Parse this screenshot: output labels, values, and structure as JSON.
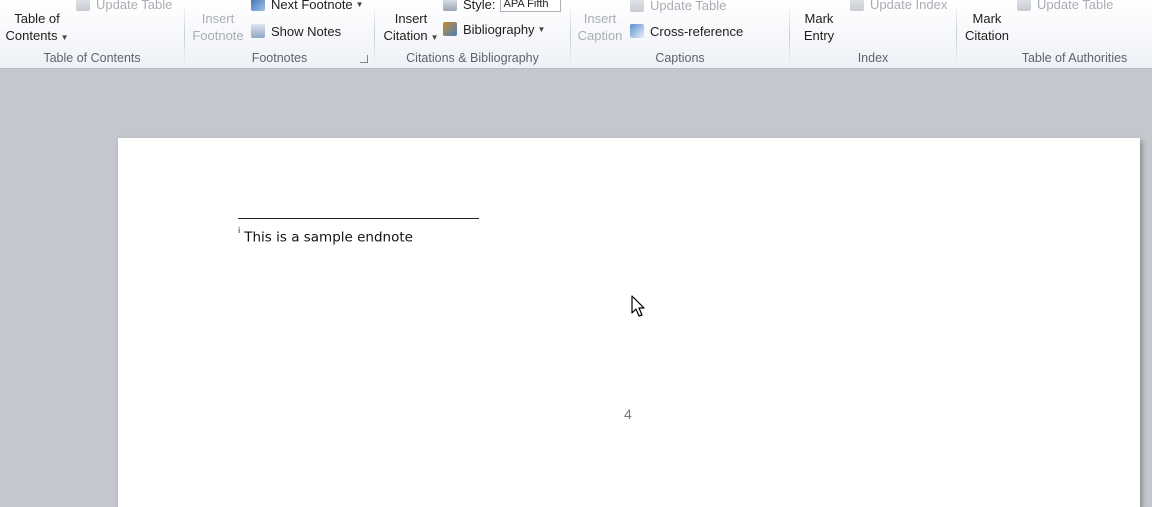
{
  "ribbon": {
    "table_of_contents": {
      "button_label_line1": "Table of",
      "button_label_line2": "Contents",
      "update_table": "Update Table",
      "group_label": "Table of Contents"
    },
    "footnotes": {
      "insert_footnote_line1": "Insert",
      "insert_footnote_line2": "Footnote",
      "next_footnote": "Next Footnote",
      "show_notes": "Show Notes",
      "group_label": "Footnotes"
    },
    "citations": {
      "insert_citation_line1": "Insert",
      "insert_citation_line2": "Citation",
      "style_label": "Style:",
      "style_value": "APA Fifth",
      "bibliography": "Bibliography",
      "group_label": "Citations & Bibliography"
    },
    "captions": {
      "insert_caption_line1": "Insert",
      "insert_caption_line2": "Caption",
      "update_table": "Update Table",
      "cross_reference": "Cross-reference",
      "group_label": "Captions"
    },
    "index": {
      "mark_entry_line1": "Mark",
      "mark_entry_line2": "Entry",
      "update_index": "Update Index",
      "group_label": "Index"
    },
    "authorities": {
      "mark_citation_line1": "Mark",
      "mark_citation_line2": "Citation",
      "update_table": "Update Table",
      "group_label": "Table of Authorities"
    }
  },
  "document": {
    "endnote_marker": "i",
    "endnote_text": "This is a sample endnote",
    "page_number": "4"
  },
  "icons": [
    "table-of-contents-icon",
    "update-table-icon",
    "insert-footnote-icon",
    "next-footnote-icon",
    "show-notes-icon",
    "insert-citation-icon",
    "style-icon",
    "bibliography-icon",
    "insert-caption-icon",
    "cross-reference-icon",
    "mark-entry-icon",
    "update-index-icon",
    "mark-citation-icon",
    "dialog-launcher-icon",
    "mouse-pointer-icon"
  ],
  "colors": {
    "ribbon_bg": "#eef1f6",
    "workspace_bg": "#c4c8ce",
    "page_bg": "#ffffff",
    "disabled_text": "#a9adb3",
    "group_label_text": "#5d6470"
  }
}
